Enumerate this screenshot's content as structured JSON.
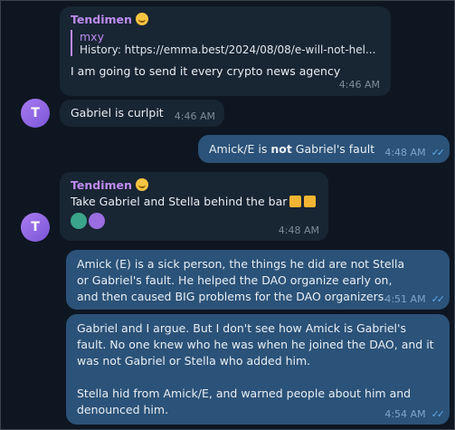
{
  "messages": [
    {
      "sender": "Tendimen",
      "reply_name": "mxy",
      "reply_text": "History: https://emma.best/2024/08/08/e-will-not-hel...",
      "text": "I am going to send it every crypto news agency",
      "time": "4:46 AM"
    },
    {
      "text": "Gabriel is curlpit",
      "time": "4:46 AM",
      "avatar_letter": "T"
    },
    {
      "text_before": "Amick/E is ",
      "text_bold": "not",
      "text_after": " Gabriel's fault",
      "time": "4:48 AM"
    },
    {
      "sender": "Tendimen",
      "text": "Take Gabriel and Stella behind the bar",
      "time": "4:48 AM",
      "avatar_letter": "T"
    },
    {
      "text": "Amick (E) is a sick person, the things he did are not Stella or Gabriel's fault. He helped the DAO organize early on, and then caused BIG problems for the DAO organizers.",
      "time": "4:51 AM"
    },
    {
      "text1": "Gabriel and I argue. But I don't see how Amick is Gabriel's fault. No one knew who he was when he joined the DAO, and it was not Gabriel or Stella who added him.",
      "text2": "Stella hid from Amick/E, and warned people about him and denounced him.",
      "time": "4:54 AM"
    }
  ],
  "colors": {
    "incoming": "#182533",
    "outgoing": "#2b5278",
    "sender": "#bd8cf0",
    "check": "#5fa8e8"
  }
}
